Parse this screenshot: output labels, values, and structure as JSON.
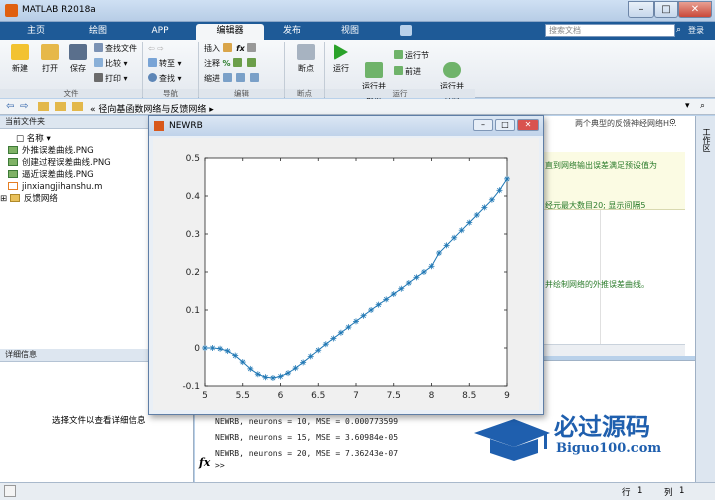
{
  "window": {
    "title": "MATLAB R2018a",
    "min": "–",
    "max": "□",
    "close": "✕"
  },
  "ribbon": {
    "tabs": [
      "主页",
      "绘图",
      "APP",
      "编辑器",
      "发布",
      "视图"
    ],
    "search_placeholder": "搜索文档",
    "login": "登录"
  },
  "toolstrip": {
    "new": "新建",
    "open": "打开",
    "save": "保存",
    "find_files": "查找文件",
    "compare": "比较",
    "print": "打印",
    "goto": "转至",
    "find": "查找",
    "insert": "插入",
    "comment": "注释",
    "indent": "缩进",
    "breakpoints": "断点",
    "run": "运行",
    "run_advance": "运行并\n前进",
    "run_section": "运行节",
    "advance": "前进",
    "run_time": "运行并\n计时",
    "sections": [
      "文件",
      "导航",
      "编辑",
      "断点",
      "运行"
    ]
  },
  "pathbar": {
    "path": "径向基函数网络与反馈网络"
  },
  "leftpanel": {
    "header": "当前文件夹",
    "name_col": "名称",
    "files": [
      "外推误差曲线.PNG",
      "创建过程误差曲线.PNG",
      "逼近误差曲线.PNG",
      "jinxiangjihanshu.m",
      "反馈网络"
    ],
    "details_header": "详细信息",
    "details_text": "选择文件以查看详细信息"
  },
  "editor": {
    "line1": "两个典型的反馈神经网络H...",
    "line2": "直到网络输出误差满足预设值为",
    "line3": "经元最大数目20;   显示间隔5",
    "line4": "并绘制网络的外推误差曲线。"
  },
  "command_window": {
    "lines": [
      "NEWRB, neurons = 10, MSE = 0.000773599",
      "NEWRB, neurons = 15, MSE = 3.60984e-05",
      "NEWRB, neurons = 20, MSE = 7.36243e-07"
    ],
    "prompt": ">>",
    "fx": "fx"
  },
  "statusbar": {
    "row_label": "行",
    "row": "1",
    "col_label": "列",
    "col": "1"
  },
  "rightstrip": {
    "label": "工作区"
  },
  "figure": {
    "title": "NEWRB",
    "buttons": [
      "–",
      "□",
      "✕"
    ]
  },
  "watermark": {
    "text": "必过源码",
    "url": "Biguo100.com"
  },
  "chart_data": {
    "type": "line",
    "xlim": [
      5,
      9
    ],
    "ylim": [
      -0.1,
      0.5
    ],
    "xticks": [
      "5",
      "5.5",
      "6",
      "6.5",
      "7",
      "7.5",
      "8",
      "8.5",
      "9"
    ],
    "yticks": [
      "-0.1",
      "0",
      "0.1",
      "0.2",
      "0.3",
      "0.4",
      "0.5"
    ],
    "grid": false,
    "color": "#1f77b4",
    "marker": "*",
    "series": [
      {
        "x": [
          5.0,
          5.1,
          5.2,
          5.3,
          5.4,
          5.5,
          5.6,
          5.7,
          5.8,
          5.9,
          6.0,
          6.1,
          6.2,
          6.3,
          6.4,
          6.5,
          6.6,
          6.7,
          6.8,
          6.9,
          7.0,
          7.1,
          7.2,
          7.3,
          7.4,
          7.5,
          7.6,
          7.7,
          7.8,
          7.9,
          8.0,
          8.1,
          8.2,
          8.3,
          8.4,
          8.5,
          8.6,
          8.7,
          8.8,
          8.9,
          9.0
        ],
        "y": [
          0.0,
          0.0,
          -0.002,
          -0.008,
          -0.02,
          -0.037,
          -0.055,
          -0.069,
          -0.077,
          -0.079,
          -0.075,
          -0.066,
          -0.053,
          -0.038,
          -0.022,
          -0.006,
          0.01,
          0.025,
          0.04,
          0.055,
          0.07,
          0.085,
          0.1,
          0.114,
          0.128,
          0.142,
          0.156,
          0.171,
          0.186,
          0.2,
          0.215,
          0.25,
          0.27,
          0.29,
          0.31,
          0.33,
          0.35,
          0.37,
          0.39,
          0.415,
          0.445
        ]
      }
    ]
  }
}
